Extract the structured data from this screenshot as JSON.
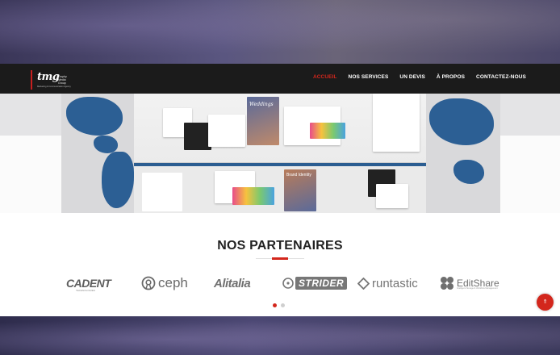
{
  "brand": {
    "logo_text": "tmg",
    "logo_side_text": "Trophy Media Group",
    "logo_subtext": "Marketing & Communication Agency"
  },
  "nav": {
    "items": [
      {
        "label": "ACCUEIL",
        "active": true
      },
      {
        "label": "NOS SERVICES",
        "active": false
      },
      {
        "label": "UN DEVIS",
        "active": false
      },
      {
        "label": "À PROPOS",
        "active": false
      },
      {
        "label": "CONTACTEZ-NOUS",
        "active": false
      }
    ]
  },
  "hero": {
    "brochure_heading": "Weddings",
    "brochure_subheading": "Brand Identity"
  },
  "partners": {
    "title": "NOS PARTENAIRES",
    "logos": [
      {
        "name": "CADENT",
        "tagline": "TECHNOLOGIES"
      },
      {
        "name": "ceph"
      },
      {
        "name": "Alitalia"
      },
      {
        "name": "STRIDER"
      },
      {
        "name": "runtastic"
      },
      {
        "name": "EditShare",
        "tagline": "Intelligent Storage & Workflow Management"
      }
    ],
    "slider": {
      "current": 1,
      "total": 2
    }
  },
  "colors": {
    "accent": "#d3261c",
    "navbar": "#1b1b1b",
    "map_blue": "#2c5f94"
  },
  "icons": {
    "scroll_top": "arrow-up-icon"
  },
  "scroll_top_glyph": "⇑"
}
